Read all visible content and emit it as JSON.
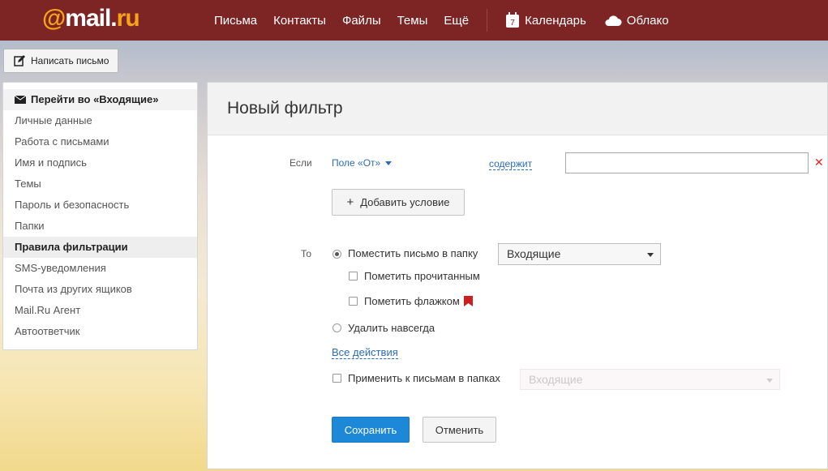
{
  "header": {
    "logo": {
      "at": "@",
      "mail": "mail",
      "dot": ".",
      "ru": "ru"
    },
    "nav": [
      "Письма",
      "Контакты",
      "Файлы",
      "Темы",
      "Ещё"
    ],
    "calendar": {
      "day": "7",
      "label": "Календарь"
    },
    "cloud": {
      "label": "Облако"
    }
  },
  "compose": {
    "label": "Написать письмо"
  },
  "sidebar": {
    "head": "Перейти во «Входящие»",
    "items": [
      "Личные данные",
      "Работа с письмами",
      "Имя и подпись",
      "Темы",
      "Пароль и безопасность",
      "Папки",
      "Правила фильтрации",
      "SMS-уведомления",
      "Почта из других ящиков",
      "Mail.Ru Агент",
      "Автоответчик"
    ],
    "active_index": 6
  },
  "filter": {
    "title": "Новый фильтр",
    "if_label": "Если",
    "field": "Поле «От»",
    "condition": "содержит",
    "value": "",
    "add_condition": "Добавить условие",
    "then_label": "То",
    "move_label": "Поместить письмо в папку",
    "move_folder": "Входящие",
    "mark_read": "Пометить прочитанным",
    "mark_flag": "Пометить флажком",
    "delete_forever": "Удалить навсегда",
    "all_actions": "Все действия",
    "apply_label": "Применить к письмам в папках",
    "apply_folder": "Входящие",
    "save": "Сохранить",
    "cancel": "Отменить"
  },
  "colors": {
    "topbar": "#7d2525",
    "accent": "#1e88d8",
    "link": "#2a6cb5",
    "flag": "#cc1f1f"
  }
}
